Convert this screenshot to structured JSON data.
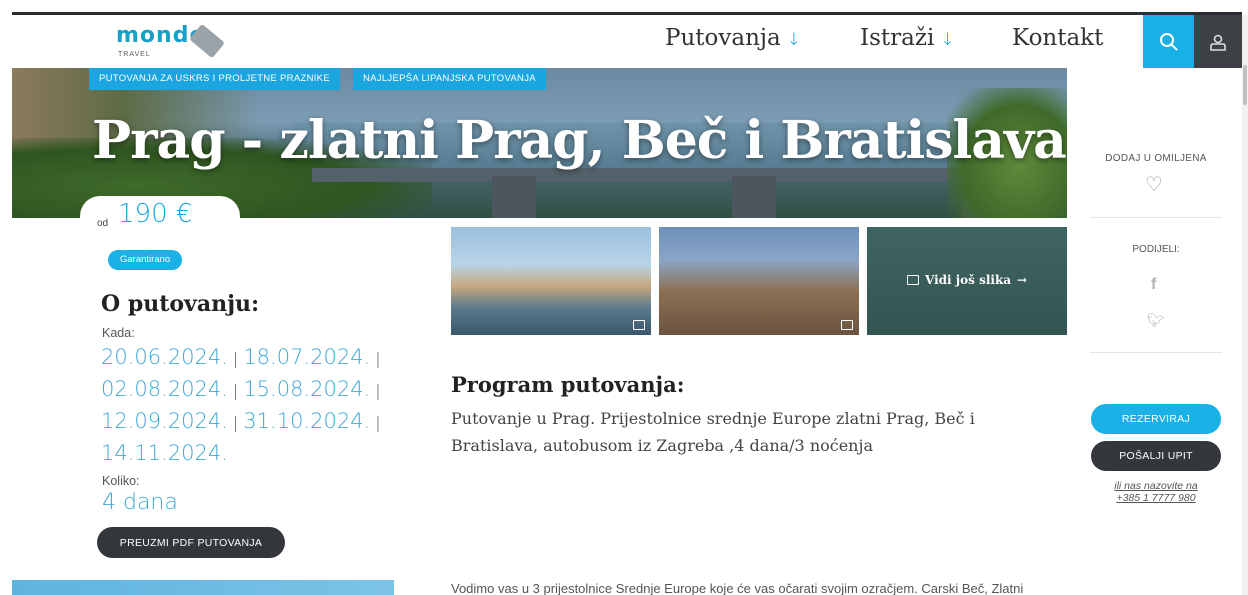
{
  "logo": {
    "word": "monde",
    "sub": "TRAVEL"
  },
  "nav": {
    "putovanja": "Putovanja",
    "istrazi": "Istraži",
    "kontakt": "Kontakt",
    "arrow": "↓"
  },
  "tags": [
    "PUTOVANJA ZA USKRS I PROLJETNE PRAZNIKE",
    "NAJLJEPŠA LIPANJSKA PUTOVANJA"
  ],
  "hero": {
    "title": "Prag - zlatni Prag, Beč i Bratislava"
  },
  "price": {
    "prefix": "od",
    "value": "190 €"
  },
  "badge": "Garantirano",
  "about": {
    "title": "O putovanju:",
    "when_label": "Kada:",
    "dates": [
      "20.06.2024.",
      "18.07.2024.",
      "02.08.2024.",
      "15.08.2024.",
      "12.09.2024.",
      "31.10.2024.",
      "14.11.2024."
    ],
    "date_sep": "|",
    "how_long_label": "Koliko:",
    "duration": "4 dana",
    "pdf_button": "PREUZMI PDF PUTOVANJA"
  },
  "gallery": {
    "more_label": "Vidi još slika",
    "more_arrow": "→"
  },
  "program": {
    "title": "Program putovanja:",
    "text": "Putovanje u Prag. Prijestolnice srednje Europe zlatni Prag, Beč i Bratislava, autobusom iz Zagreba ,4 dana/3 noćenja",
    "desc": "Vodimo vas u 3 prijestolnice Srednje Europe koje će vas očarati svojim ozračjem. Carski Beč, Zlatni"
  },
  "sidebar": {
    "favorite_label": "DODAJ U OMILJENA",
    "share_label": "PODIJELI:",
    "book_button": "REZERVIRAJ",
    "inquiry_button": "POŠALJI UPIT",
    "call_line1": "ili nas nazovite na",
    "call_line2": "+385 1 7777 980"
  },
  "colors": {
    "accent": "#1bb0e6",
    "dark": "#33373b"
  }
}
